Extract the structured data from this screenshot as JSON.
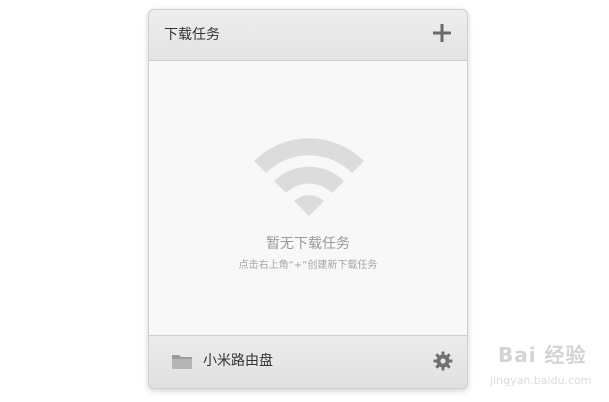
{
  "panel": {
    "title": "下载任务",
    "add_icon": "plus-icon"
  },
  "empty_state": {
    "icon": "wifi-icon",
    "title": "暂无下载任务",
    "hint": "点击右上角“+”创建新下载任务"
  },
  "footer": {
    "folder_icon": "folder-icon",
    "storage_label": "小米路由盘",
    "settings_icon": "gear-icon"
  },
  "watermark": {
    "text": "Bai 经验",
    "sub": "jingyan.baidu.com"
  },
  "colors": {
    "header_bg": "#e6e6e6",
    "content_bg": "#f8f8f8",
    "icon_gray": "#dcdcdc",
    "title_text": "#333333",
    "muted_text": "#9a9a9a"
  }
}
